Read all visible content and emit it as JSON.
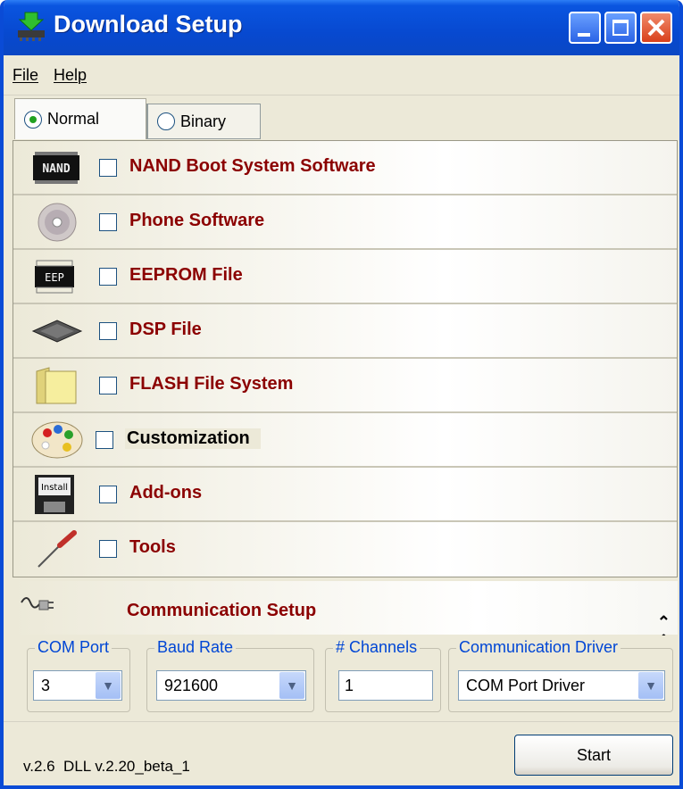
{
  "window": {
    "title": "Download Setup",
    "controls": [
      "minimize",
      "maximize",
      "close"
    ]
  },
  "menu": {
    "items": [
      {
        "label": "File",
        "mnemonic": "F"
      },
      {
        "label": "Help",
        "mnemonic": "H"
      }
    ]
  },
  "tabs": [
    {
      "label": "Normal",
      "selected": true
    },
    {
      "label": "Binary",
      "selected": false
    }
  ],
  "components": [
    {
      "label": "NAND Boot System Software",
      "icon": "nand-chip-icon",
      "checked": false
    },
    {
      "label": "Phone Software",
      "icon": "cd-disc-icon",
      "checked": false
    },
    {
      "label": "EEPROM File",
      "icon": "eeprom-chip-icon",
      "checked": false
    },
    {
      "label": "DSP File",
      "icon": "processor-chip-icon",
      "checked": false
    },
    {
      "label": "FLASH File System",
      "icon": "folder-icon",
      "checked": false
    },
    {
      "label": "Customization",
      "icon": "palette-icon",
      "checked": false
    },
    {
      "label": "Add-ons",
      "icon": "install-disk-icon",
      "checked": false
    },
    {
      "label": "Tools",
      "icon": "screwdriver-icon",
      "checked": false
    }
  ],
  "communication": {
    "header": "Communication Setup",
    "com_port": {
      "label": "COM Port",
      "value": "3"
    },
    "baud_rate": {
      "label": "Baud Rate",
      "value": "921600"
    },
    "channels": {
      "label": "# Channels",
      "value": "1"
    },
    "driver": {
      "label": "Communication Driver",
      "value": "COM Port Driver"
    }
  },
  "footer": {
    "version": "v.2.6  DLL v.2.20_beta_1",
    "start_label": "Start"
  },
  "colors": {
    "title_blue": "#0749d0",
    "label_red": "#8b0000",
    "group_blue": "#0046d5",
    "radio_green": "#21a121"
  }
}
